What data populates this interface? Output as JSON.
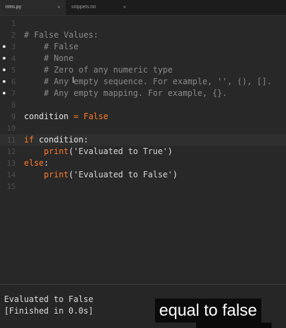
{
  "tabs": [
    {
      "label": "intro.py",
      "close": "×",
      "active": true
    },
    {
      "label": "snippets.txt",
      "close": "×",
      "active": false
    }
  ],
  "editor": {
    "lines": [
      {
        "n": "1",
        "bm": false,
        "cur": false,
        "segs": []
      },
      {
        "n": "2",
        "bm": false,
        "cur": false,
        "segs": [
          {
            "c": "cm",
            "t": "# False Values:"
          }
        ]
      },
      {
        "n": "3",
        "bm": true,
        "cur": false,
        "segs": [
          {
            "c": "cm",
            "t": "    # False"
          }
        ]
      },
      {
        "n": "4",
        "bm": true,
        "cur": false,
        "segs": [
          {
            "c": "cm",
            "t": "    # None"
          }
        ]
      },
      {
        "n": "5",
        "bm": true,
        "cur": false,
        "segs": [
          {
            "c": "cm",
            "t": "    # Zero of any numeric type"
          }
        ]
      },
      {
        "n": "6",
        "bm": true,
        "cur": false,
        "segs": [
          {
            "c": "cm",
            "t": "    # Any empty sequence. For example, '', (), []."
          }
        ]
      },
      {
        "n": "7",
        "bm": true,
        "cur": false,
        "segs": [
          {
            "c": "cm",
            "t": "    # Any empty mapping. For example, {}."
          }
        ]
      },
      {
        "n": "8",
        "bm": false,
        "cur": false,
        "segs": []
      },
      {
        "n": "9",
        "bm": false,
        "cur": false,
        "segs": [
          {
            "c": "",
            "t": "condition "
          },
          {
            "c": "kw",
            "t": "="
          },
          {
            "c": "",
            "t": " "
          },
          {
            "c": "kw",
            "t": "False"
          }
        ]
      },
      {
        "n": "10",
        "bm": false,
        "cur": false,
        "segs": []
      },
      {
        "n": "11",
        "bm": false,
        "cur": true,
        "segs": [
          {
            "c": "kw",
            "t": "if"
          },
          {
            "c": "",
            "t": " condition:"
          }
        ]
      },
      {
        "n": "12",
        "bm": false,
        "cur": false,
        "segs": [
          {
            "c": "",
            "t": "    "
          },
          {
            "c": "kw",
            "t": "print"
          },
          {
            "c": "",
            "t": "("
          },
          {
            "c": "str",
            "t": "'Evaluated to True'"
          },
          {
            "c": "",
            "t": ")"
          }
        ]
      },
      {
        "n": "13",
        "bm": false,
        "cur": false,
        "segs": [
          {
            "c": "kw",
            "t": "else"
          },
          {
            "c": "",
            "t": ":"
          }
        ]
      },
      {
        "n": "14",
        "bm": false,
        "cur": false,
        "segs": [
          {
            "c": "",
            "t": "    "
          },
          {
            "c": "kw",
            "t": "print"
          },
          {
            "c": "",
            "t": "("
          },
          {
            "c": "str",
            "t": "'Evaluated to False'"
          },
          {
            "c": "",
            "t": ")"
          }
        ]
      },
      {
        "n": "15",
        "bm": false,
        "cur": false,
        "segs": []
      }
    ]
  },
  "output": {
    "lines": [
      "Evaluated to False",
      "[Finished in 0.0s]"
    ]
  },
  "caption": {
    "text": "equal to false"
  },
  "colors": {
    "keyword": "#ff7a2a",
    "comment": "#8a8a8a",
    "background": "#282828"
  }
}
